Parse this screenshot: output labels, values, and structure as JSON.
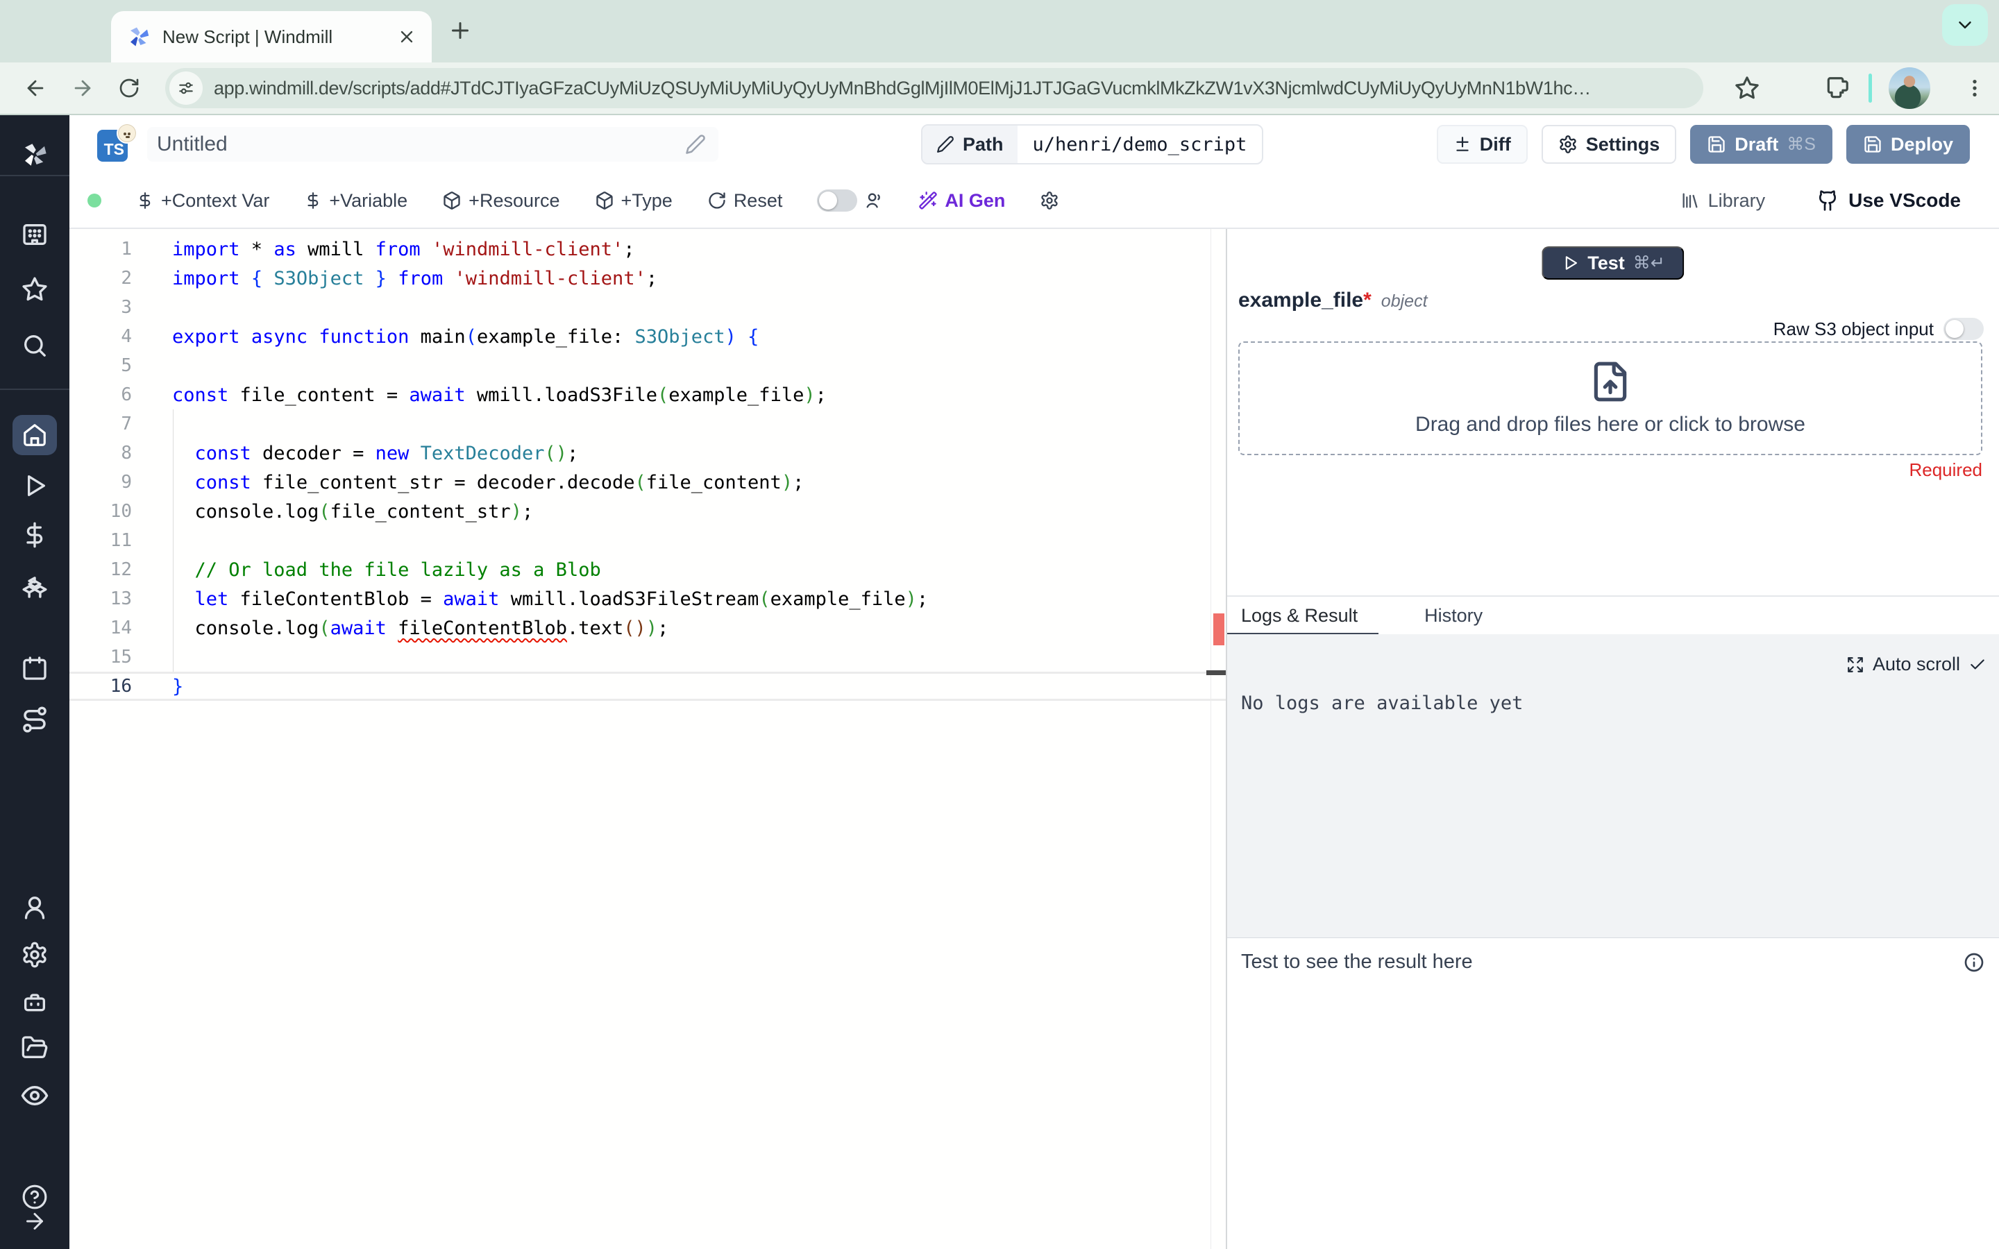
{
  "browser": {
    "tab_title": "New Script | Windmill",
    "url": "app.windmill.dev/scripts/add#JTdCJTIyaGFzaCUyMiUzQSUyMiUyMiUyQyUyMnBhdGglMjIlM0ElMjJ1JTJGaGVucmklMkZkZW1vX3NjcmlwdCUyMiUyQyUyMnN1bW1hc…"
  },
  "header": {
    "language_badge": "TS",
    "script_name": "Untitled",
    "path_label": "Path",
    "path_value": "u/henri/demo_script",
    "diff_label": "Diff",
    "settings_label": "Settings",
    "draft_label": "Draft",
    "draft_shortcut": "⌘S",
    "deploy_label": "Deploy"
  },
  "toolbar": {
    "context_var_label": "+Context Var",
    "variable_label": "+Variable",
    "resource_label": "+Resource",
    "type_label": "+Type",
    "reset_label": "Reset",
    "ai_gen_label": "AI Gen",
    "library_label": "Library",
    "use_vscode_label": "Use VScode"
  },
  "editor": {
    "active_line": 16,
    "lines": [
      [
        [
          "k",
          "import"
        ],
        [
          "d",
          " * "
        ],
        [
          "k",
          "as"
        ],
        [
          "d",
          " wmill "
        ],
        [
          "k",
          "from"
        ],
        [
          "d",
          " "
        ],
        [
          "s",
          "'windmill-client'"
        ],
        [
          "d",
          ";"
        ]
      ],
      [
        [
          "k",
          "import"
        ],
        [
          "d",
          " "
        ],
        [
          "b",
          "{"
        ],
        [
          "d",
          " "
        ],
        [
          "t",
          "S3Object"
        ],
        [
          "d",
          " "
        ],
        [
          "b",
          "}"
        ],
        [
          "d",
          " "
        ],
        [
          "k",
          "from"
        ],
        [
          "d",
          " "
        ],
        [
          "s",
          "'windmill-client'"
        ],
        [
          "d",
          ";"
        ]
      ],
      [],
      [
        [
          "k",
          "export"
        ],
        [
          "d",
          " "
        ],
        [
          "k",
          "async"
        ],
        [
          "d",
          " "
        ],
        [
          "k",
          "function"
        ],
        [
          "d",
          " main"
        ],
        [
          "b",
          "("
        ],
        [
          "d",
          "example_file: "
        ],
        [
          "t",
          "S3Object"
        ],
        [
          "b",
          ")"
        ],
        [
          "d",
          " "
        ],
        [
          "b",
          "{"
        ]
      ],
      [],
      [
        [
          "k",
          "const"
        ],
        [
          "d",
          " file_content = "
        ],
        [
          "k",
          "await"
        ],
        [
          "d",
          " wmill.loadS3File"
        ],
        [
          "g",
          "("
        ],
        [
          "d",
          "example_file"
        ],
        [
          "g",
          ")"
        ],
        [
          "d",
          ";"
        ]
      ],
      [],
      [
        [
          "d",
          "  "
        ],
        [
          "k",
          "const"
        ],
        [
          "d",
          " decoder = "
        ],
        [
          "k",
          "new"
        ],
        [
          "d",
          " "
        ],
        [
          "t",
          "TextDecoder"
        ],
        [
          "g",
          "()"
        ],
        [
          "d",
          ";"
        ]
      ],
      [
        [
          "d",
          "  "
        ],
        [
          "k",
          "const"
        ],
        [
          "d",
          " file_content_str = decoder.decode"
        ],
        [
          "g",
          "("
        ],
        [
          "d",
          "file_content"
        ],
        [
          "g",
          ")"
        ],
        [
          "d",
          ";"
        ]
      ],
      [
        [
          "d",
          "  console.log"
        ],
        [
          "g",
          "("
        ],
        [
          "d",
          "file_content_str"
        ],
        [
          "g",
          ")"
        ],
        [
          "d",
          ";"
        ]
      ],
      [],
      [
        [
          "c",
          "  // Or load the file lazily as a Blob"
        ]
      ],
      [
        [
          "d",
          "  "
        ],
        [
          "k",
          "let"
        ],
        [
          "d",
          " fileContentBlob = "
        ],
        [
          "k",
          "await"
        ],
        [
          "d",
          " wmill.loadS3FileStream"
        ],
        [
          "g",
          "("
        ],
        [
          "d",
          "example_file"
        ],
        [
          "g",
          ")"
        ],
        [
          "d",
          ";"
        ]
      ],
      [
        [
          "d",
          "  console.log"
        ],
        [
          "g",
          "("
        ],
        [
          "k",
          "await"
        ],
        [
          "d",
          " "
        ],
        [
          "e",
          "fileContentBlob"
        ],
        [
          "d",
          ".text"
        ],
        [
          "br",
          "()"
        ],
        [
          "g",
          ")"
        ],
        [
          "d",
          ";"
        ]
      ],
      [],
      [
        [
          "b",
          "}"
        ]
      ]
    ]
  },
  "right_panel": {
    "test_label": "Test",
    "test_shortcut": "⌘↵",
    "arg_name": "example_file",
    "arg_required_mark": "*",
    "arg_type": "object",
    "raw_s3_label": "Raw S3 object input",
    "dropzone_text": "Drag and drop files here or click to browse",
    "required_label": "Required",
    "tabs": [
      "Logs & Result",
      "History"
    ],
    "auto_scroll_label": "Auto scroll",
    "no_logs_text": "No logs are available yet",
    "result_placeholder": "Test to see the result here"
  },
  "colors": {
    "chrome_bg": "#d6e4de",
    "url_pill": "#dce8e2",
    "accent_slate_button": "#6b84a6",
    "test_button_navy": "#333e55",
    "ai_gen_purple": "#6d28d9",
    "required_red": "#dc2626",
    "error_marker": "#f0706a",
    "status_green_dot": "#7bdf9e",
    "sidebar_bg": "#1b212c",
    "keyword_blue": "#0000ff",
    "string_red": "#a31515",
    "type_teal": "#267f99",
    "comment_green": "#008000"
  }
}
